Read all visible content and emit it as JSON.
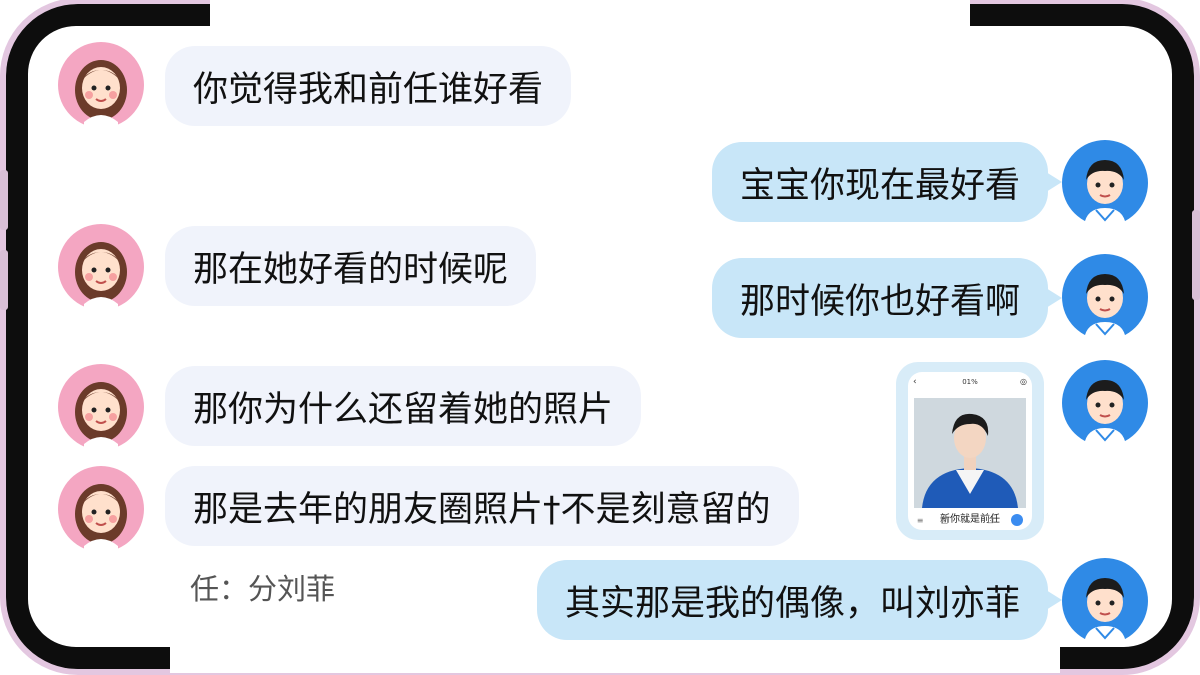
{
  "colors": {
    "left_bubble": "#f0f3fb",
    "right_bubble": "#c8e6f8",
    "frame": "#0d0d0d",
    "frame_outline": "#e3c7e0"
  },
  "messages": [
    {
      "side": "left",
      "text": "你觉得我和前任谁好看"
    },
    {
      "side": "right",
      "text": "宝宝你现在最好看"
    },
    {
      "side": "left",
      "text": "那在她好看的时候呢"
    },
    {
      "side": "right",
      "text": "那时候你也好看啊"
    },
    {
      "side": "left",
      "text": "那你为什么还留着她的照片"
    },
    {
      "side": "left",
      "text": "那是去年的朋友圈照片†不是刻意留的"
    },
    {
      "side": "right",
      "text": "其实那是我的偶像，叫刘亦菲"
    }
  ],
  "caption": "任：分刘菲",
  "thumbnail": {
    "top_label": "01%",
    "caption": "新你就是前任",
    "icons": [
      "back-icon",
      "camera-icon",
      "send-icon"
    ]
  },
  "avatars": {
    "girl": "girl-avatar",
    "boy": "boy-avatar"
  }
}
